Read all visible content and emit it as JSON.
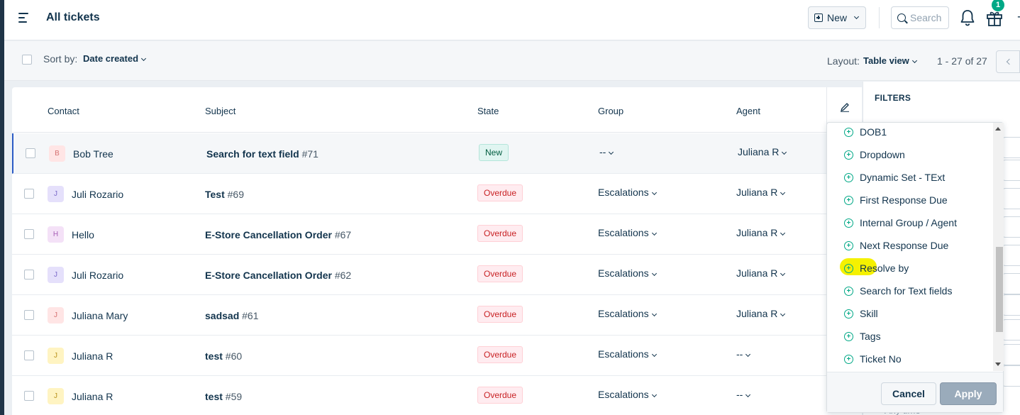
{
  "header": {
    "title": "All tickets",
    "new_label": "New",
    "search_placeholder": "Search",
    "gift_badge": "1",
    "extra_glyph": "+"
  },
  "toolbar": {
    "sort_label": "Sort by:",
    "sort_value": "Date created",
    "layout_label": "Layout:",
    "layout_value": "Table view",
    "pagination": "1 - 27 of 27"
  },
  "table": {
    "columns": [
      "Contact",
      "Subject",
      "State",
      "Group",
      "Agent"
    ],
    "rows": [
      {
        "initial": "B",
        "contact": "Bob Tree",
        "subject": "Search for text field",
        "num": "#71",
        "state": "New",
        "state_type": "new",
        "group": "--",
        "agent": "Juliana R",
        "avatar_bg": "#ffe5e5",
        "avatar_fg": "#d57070"
      },
      {
        "initial": "J",
        "contact": "Juli Rozario",
        "subject": "Test",
        "num": "#69",
        "state": "Overdue",
        "state_type": "overdue",
        "group": "Escalations",
        "agent": "Juliana R",
        "avatar_bg": "#e5e0fb",
        "avatar_fg": "#7a68c8"
      },
      {
        "initial": "H",
        "contact": "Hello",
        "subject": "E-Store Cancellation Order",
        "num": "#67",
        "state": "Overdue",
        "state_type": "overdue",
        "group": "Escalations",
        "agent": "Juliana R",
        "avatar_bg": "#f4e1f7",
        "avatar_fg": "#a65db5"
      },
      {
        "initial": "J",
        "contact": "Juli Rozario",
        "subject": "E-Store Cancellation Order",
        "num": "#62",
        "state": "Overdue",
        "state_type": "overdue",
        "group": "Escalations",
        "agent": "Juliana R",
        "avatar_bg": "#e5e0fb",
        "avatar_fg": "#7a68c8"
      },
      {
        "initial": "J",
        "contact": "Juliana Mary",
        "subject": "sadsad",
        "num": "#61",
        "state": "Overdue",
        "state_type": "overdue",
        "group": "Escalations",
        "agent": "Juliana R",
        "avatar_bg": "#ffe5e5",
        "avatar_fg": "#d57070"
      },
      {
        "initial": "J",
        "contact": "Juliana R",
        "subject": "test",
        "num": "#60",
        "state": "Overdue",
        "state_type": "overdue",
        "group": "Escalations",
        "agent": "--",
        "avatar_bg": "#fff4c2",
        "avatar_fg": "#b8901a"
      },
      {
        "initial": "J",
        "contact": "Juliana R",
        "subject": "test",
        "num": "#59",
        "state": "Overdue",
        "state_type": "overdue",
        "group": "Escalations",
        "agent": "--",
        "avatar_bg": "#fff4c2",
        "avatar_fg": "#b8901a"
      }
    ]
  },
  "field_dropdown": {
    "items": [
      "DOB1",
      "Dropdown",
      "Dynamic Set - TExt",
      "First Response Due",
      "Internal Group / Agent",
      "Next Response Due",
      "Resolve by",
      "Search for Text fields",
      "Skill",
      "Tags",
      "Ticket No"
    ],
    "cancel_label": "Cancel",
    "apply_label": "Apply"
  },
  "filters": {
    "title": "FILTERS",
    "partial_text": "Any time"
  },
  "colors": {
    "accent": "#2c5cc5",
    "plus_green": "#00a886",
    "highlight": "#f5f100"
  }
}
